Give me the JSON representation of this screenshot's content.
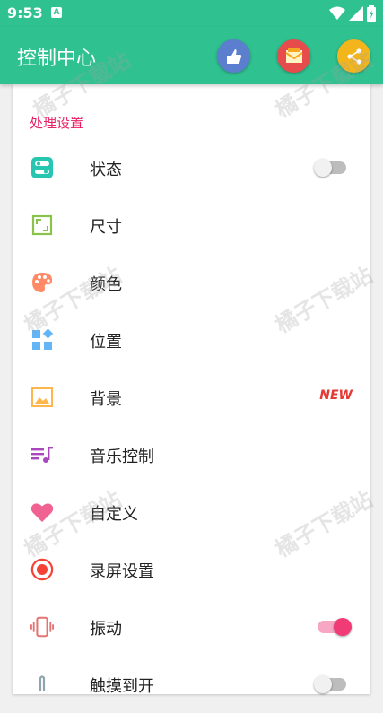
{
  "status_bar": {
    "time": "9:53",
    "notification_icon": "A"
  },
  "app_bar": {
    "title": "控制中心",
    "actions": [
      "thumbs-up-icon",
      "message-icon",
      "share-icon"
    ]
  },
  "section": {
    "title": "处理设置"
  },
  "items": [
    {
      "label": "状态",
      "icon": "toggle-icon",
      "control": "switch-off"
    },
    {
      "label": "尺寸",
      "icon": "resize-icon"
    },
    {
      "label": "颜色",
      "icon": "palette-icon"
    },
    {
      "label": "位置",
      "icon": "grid-icon"
    },
    {
      "label": "背景",
      "icon": "image-icon",
      "badge": "NEW"
    },
    {
      "label": "音乐控制",
      "icon": "music-icon"
    },
    {
      "label": "自定义",
      "icon": "heart-icon"
    },
    {
      "label": "录屏设置",
      "icon": "record-icon"
    },
    {
      "label": "振动",
      "icon": "vibrate-icon",
      "control": "switch-on"
    },
    {
      "label": "触摸到开",
      "icon": "touch-icon",
      "control": "switch-off"
    }
  ],
  "watermark": "橘子下载站",
  "colors": {
    "primary": "#30c191",
    "accent": "#e91e63",
    "badge": "#e53935"
  }
}
